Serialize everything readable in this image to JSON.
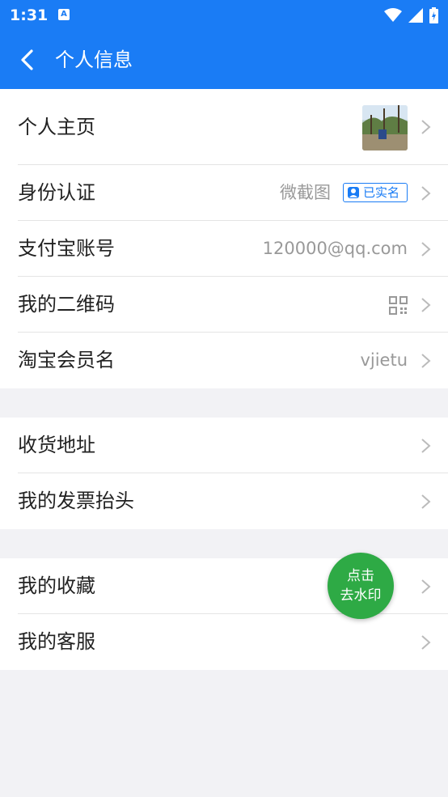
{
  "status_bar": {
    "time": "1:31",
    "notification_icon": "A"
  },
  "app_bar": {
    "title": "个人信息",
    "back_icon": "chevron-left-icon"
  },
  "groups": [
    {
      "rows": [
        {
          "label": "个人主页",
          "trailing": "avatar-photo"
        },
        {
          "label": "身份认证",
          "value": "微截图",
          "badge": "已实名"
        },
        {
          "label": "支付宝账号",
          "value": "120000@qq.com"
        },
        {
          "label": "我的二维码",
          "trailing": "qrcode-icon"
        },
        {
          "label": "淘宝会员名",
          "value": "vjietu"
        }
      ]
    },
    {
      "rows": [
        {
          "label": "收货地址"
        },
        {
          "label": "我的发票抬头"
        }
      ]
    },
    {
      "rows": [
        {
          "label": "我的收藏"
        },
        {
          "label": "我的客服"
        }
      ]
    }
  ],
  "fab": {
    "line1": "点击",
    "line2": "去水印"
  },
  "colors": {
    "accent": "#1a7cf5",
    "fab": "#2eaa45",
    "background": "#f2f2f5"
  }
}
